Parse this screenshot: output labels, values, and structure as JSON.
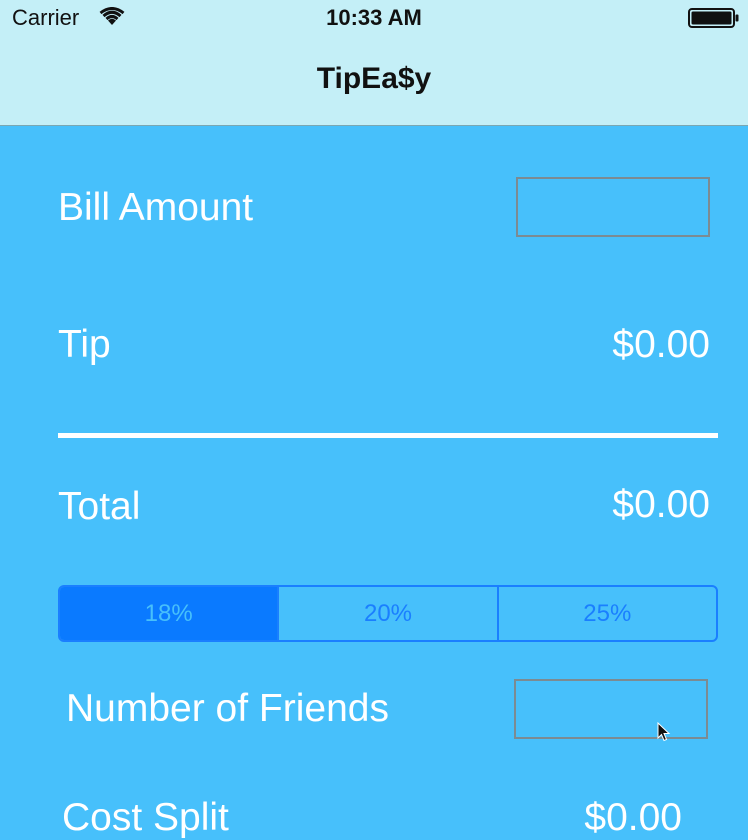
{
  "status_bar": {
    "carrier": "Carrier",
    "time": "10:33 AM",
    "wifi_icon": "wifi-icon",
    "battery_icon": "battery-icon"
  },
  "nav": {
    "title": "TipEa$y"
  },
  "form": {
    "bill_amount_label": "Bill Amount",
    "bill_amount_value": "",
    "tip_label": "Tip",
    "tip_value": "$0.00",
    "total_label": "Total",
    "total_value": "$0.00",
    "tip_options": [
      "18%",
      "20%",
      "25%"
    ],
    "selected_tip_index": 0,
    "friends_label": "Number of Friends",
    "friends_value": "",
    "cost_split_label": "Cost Split",
    "cost_split_value": "$0.00"
  },
  "colors": {
    "background": "#47c0fb",
    "nav_background": "#c4eff7",
    "accent": "#0a7aff",
    "text": "#ffffff"
  }
}
